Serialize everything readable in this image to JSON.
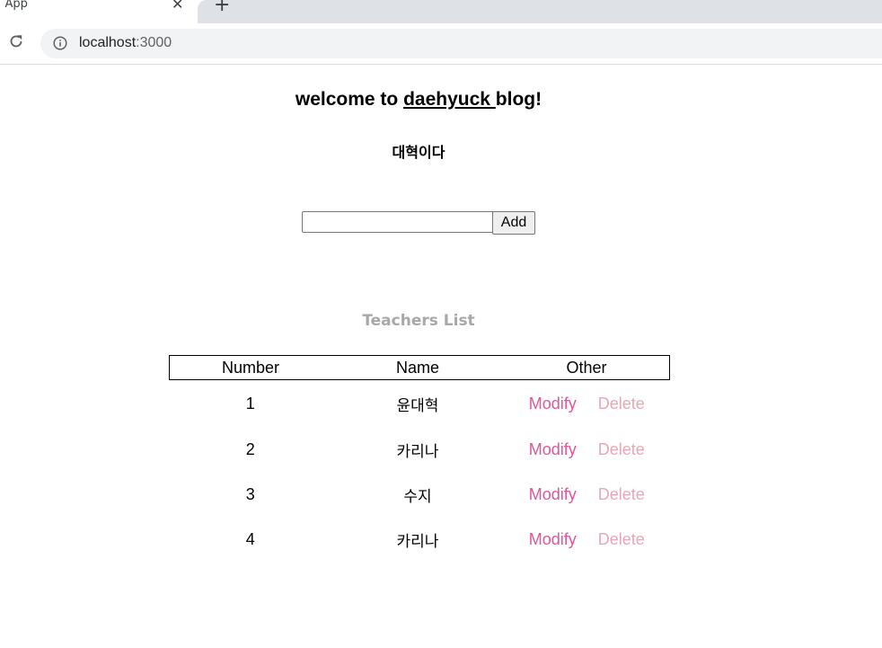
{
  "browser": {
    "tab_title": ": App",
    "tab_close": "✕",
    "new_tab": "+",
    "url_host": "localhost",
    "url_port": ":3000"
  },
  "page": {
    "headline_prefix": "welcome to ",
    "headline_link": "daehyuck ",
    "headline_suffix": "blog!",
    "subtitle": "대혁이다",
    "input_value": "",
    "add_label": "Add",
    "list_title": "Teachers List"
  },
  "table": {
    "headers": [
      "Number",
      "Name",
      "Other"
    ],
    "rows": [
      {
        "number": "1",
        "name": "윤대혁",
        "modify": "Modify",
        "delete": "Delete"
      },
      {
        "number": "2",
        "name": "카리나",
        "modify": "Modify",
        "delete": "Delete"
      },
      {
        "number": "3",
        "name": "수지",
        "modify": "Modify",
        "delete": "Delete"
      },
      {
        "number": "4",
        "name": "카리나",
        "modify": "Modify",
        "delete": "Delete"
      }
    ]
  },
  "colors": {
    "modify": "#e0559a",
    "delete": "#e8a7b4",
    "list_title": "#a8a8a8"
  }
}
